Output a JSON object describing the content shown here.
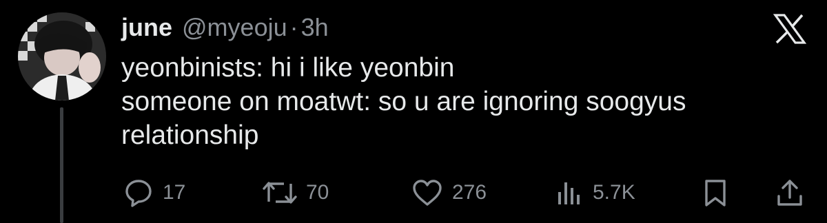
{
  "tweet": {
    "author": {
      "display_name": "june",
      "handle": "@myeoju",
      "separator": "·",
      "time_ago": "3h"
    },
    "text_lines": [
      "yeonbinists: hi i like yeonbin",
      "someone on moatwt: so u are ignoring soogyus",
      "relationship"
    ],
    "actions": {
      "reply": {
        "icon": "reply-icon",
        "count": "17"
      },
      "retweet": {
        "icon": "retweet-icon",
        "count": "70"
      },
      "like": {
        "icon": "heart-icon",
        "count": "276"
      },
      "views": {
        "icon": "views-icon",
        "count": "5.7K"
      },
      "bookmark": {
        "icon": "bookmark-icon"
      },
      "share": {
        "icon": "share-icon"
      }
    }
  },
  "brand": {
    "logo": "x-logo-icon"
  },
  "colors": {
    "background": "#000000",
    "text_primary": "#e7e9ea",
    "text_secondary": "#8b9096",
    "thread_line": "#3a3d40"
  }
}
